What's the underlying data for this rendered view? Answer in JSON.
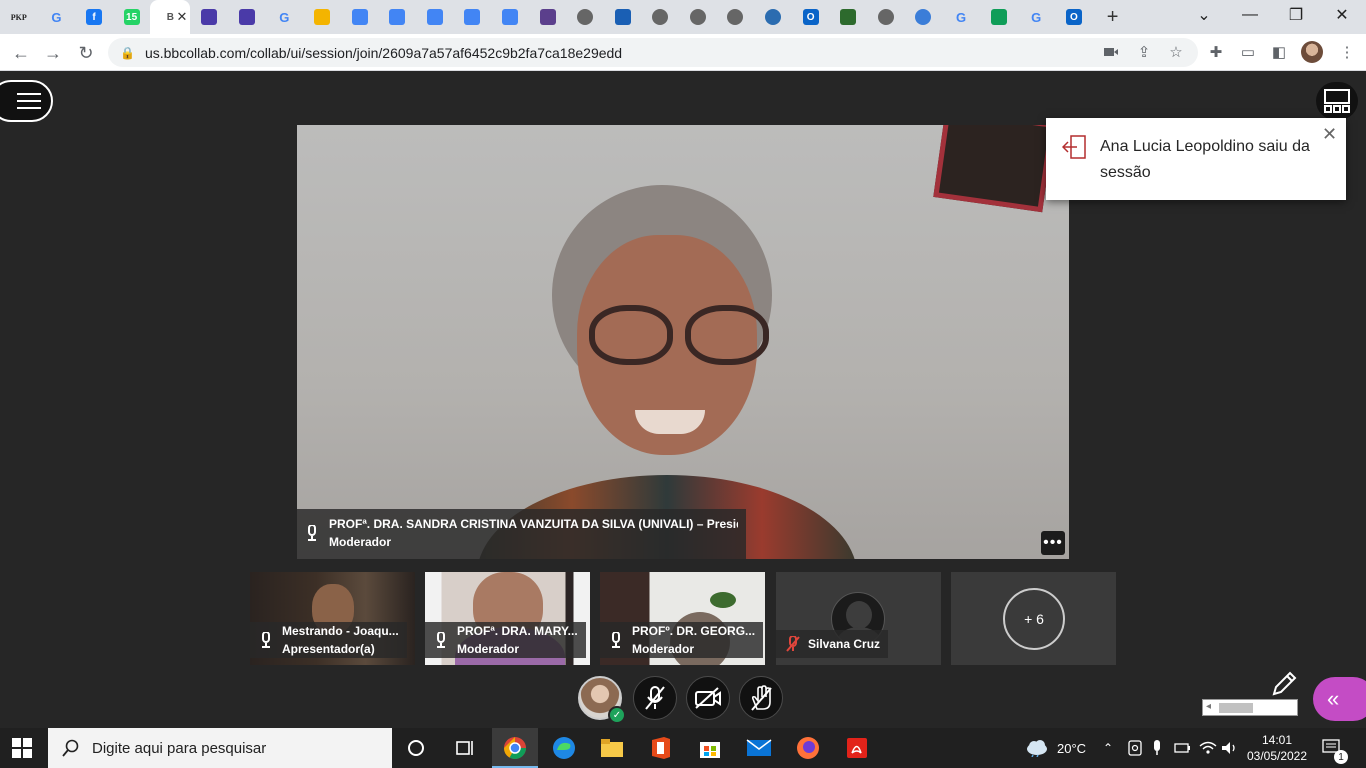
{
  "browser": {
    "tabs": [
      {
        "icon": "pkp-icon",
        "text": "PKP",
        "color": "#ffffff"
      },
      {
        "icon": "google-icon",
        "text": "G",
        "color": "#4285f4"
      },
      {
        "icon": "facebook-icon",
        "text": "f",
        "color": "#1877f2"
      },
      {
        "icon": "whatsapp-icon",
        "text": "15",
        "color": "#25d366"
      },
      {
        "icon": "collab-icon",
        "text": "",
        "color": "#444"
      },
      {
        "icon": "collab-icon",
        "text": "",
        "color": "#4a3aa8"
      },
      {
        "icon": "collab-icon",
        "text": "",
        "color": "#4a3aa8"
      },
      {
        "icon": "google-icon",
        "text": "G",
        "color": "#4285f4"
      },
      {
        "icon": "slides-icon",
        "text": "",
        "color": "#f4b400"
      },
      {
        "icon": "docs-icon",
        "text": "",
        "color": "#4285f4"
      },
      {
        "icon": "docs-icon",
        "text": "",
        "color": "#4285f4"
      },
      {
        "icon": "docs-icon",
        "text": "",
        "color": "#4285f4"
      },
      {
        "icon": "docs-icon",
        "text": "",
        "color": "#4285f4"
      },
      {
        "icon": "docs-icon",
        "text": "",
        "color": "#4285f4"
      },
      {
        "icon": "app-icon",
        "text": "",
        "color": "#5b3f8c"
      },
      {
        "icon": "globe-icon",
        "text": "",
        "color": "#666"
      },
      {
        "icon": "mail-icon",
        "text": "",
        "color": "#1a5fb4"
      },
      {
        "icon": "globe-icon",
        "text": "",
        "color": "#666"
      },
      {
        "icon": "globe-icon",
        "text": "",
        "color": "#666"
      },
      {
        "icon": "globe-icon",
        "text": "",
        "color": "#666"
      },
      {
        "icon": "edge-icon",
        "text": "",
        "color": "#2b6cb0"
      },
      {
        "icon": "outlook-icon",
        "text": "O",
        "color": "#0a64c8"
      },
      {
        "icon": "tree-icon",
        "text": "",
        "color": "#2d6a2d"
      },
      {
        "icon": "globe-icon",
        "text": "",
        "color": "#666"
      },
      {
        "icon": "chrome-app-icon",
        "text": "",
        "color": "#3b7dd8"
      },
      {
        "icon": "google-icon",
        "text": "G",
        "color": "#4285f4"
      },
      {
        "icon": "drive-icon",
        "text": "",
        "color": "#0f9d58"
      },
      {
        "icon": "google-icon",
        "text": "G",
        "color": "#4285f4"
      },
      {
        "icon": "outlook-icon",
        "text": "O",
        "color": "#0a64c8"
      }
    ],
    "active_tab_index": 4,
    "active_tab_label": "B",
    "url": "us.bbcollab.com/collab/ui/session/join/2609a7a57af6452c9b2fa7ca18e29edd"
  },
  "session": {
    "main_speaker": {
      "name": "PROFª. DRA. SANDRA CRISTINA VANZUITA DA SILVA (UNIVALI) – Presid",
      "role": "Moderador"
    },
    "more_label": "•••",
    "notification": {
      "text": "Ana Lucia Leopoldino saiu da sessão",
      "close": "✕"
    },
    "participants": [
      {
        "name": "Mestrando - Joaqu...",
        "role": "Apresentador(a)",
        "muted": false
      },
      {
        "name": "PROFª. DRA. MARY...",
        "role": "Moderador",
        "muted": false
      },
      {
        "name": "PROFº. DR. GEORG...",
        "role": "Moderador",
        "muted": false
      },
      {
        "name": "Silvana Cruz",
        "role": "",
        "muted": true
      }
    ],
    "more_participants": "+ 6"
  },
  "taskbar": {
    "search_placeholder": "Digite aqui para pesquisar",
    "weather": "20°C",
    "time": "14:01",
    "date": "03/05/2022",
    "notifications": "1"
  },
  "colors": {
    "collab_accent": "#c44cc5",
    "status_ok": "#1ea35b",
    "muted_red": "#e0463c"
  }
}
